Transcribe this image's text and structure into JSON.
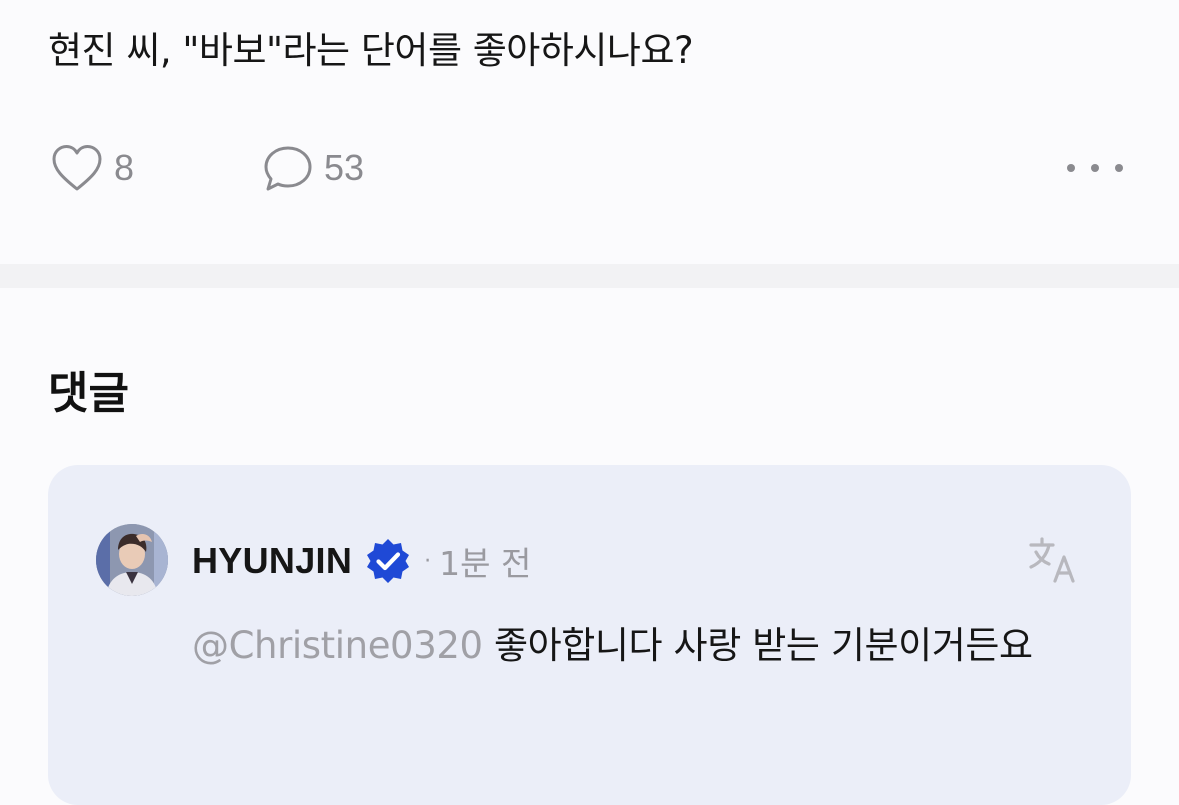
{
  "post": {
    "text": "현진 씨, \"바보\"라는 단어를 좋아하시나요?",
    "like_count": "8",
    "comment_count": "53",
    "icons": {
      "like": "heart-outline-icon",
      "comment": "speech-bubble-icon",
      "more": "more-horizontal-icon"
    }
  },
  "comments_section": {
    "title": "댓글",
    "comments": [
      {
        "author": "HYUNJIN",
        "verified": true,
        "separator": "·",
        "time": "1분 전",
        "mention": "@Christine0320",
        "text": "좋아합니다 사랑 받는 기분이거든요",
        "icons": {
          "verified": "verified-badge-icon",
          "translate": "translate-icon"
        }
      }
    ]
  },
  "colors": {
    "background": "#fbfbfd",
    "divider": "#f2f2f4",
    "comment_card": "#ebeef8",
    "verified_blue": "#1f49d6",
    "muted_text": "#9a9aa0"
  }
}
